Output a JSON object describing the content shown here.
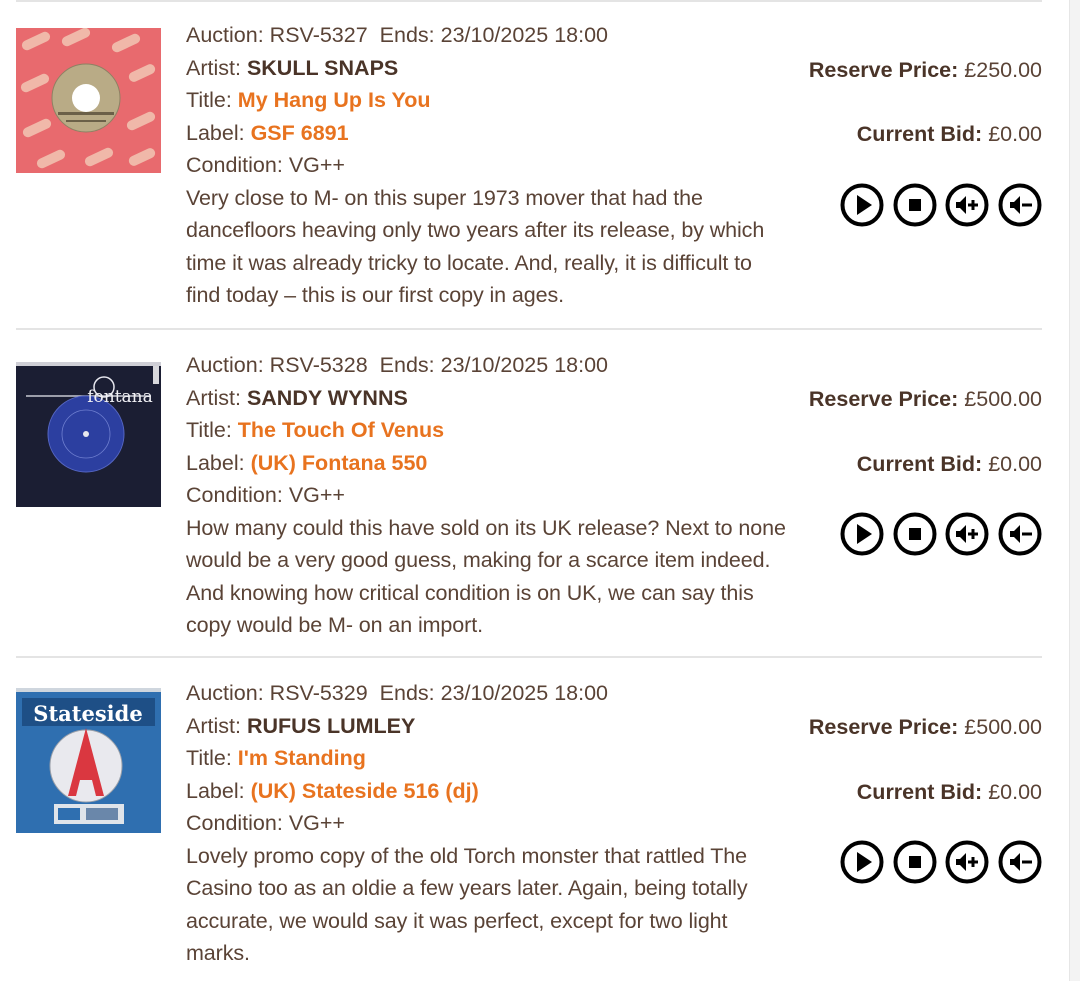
{
  "labels": {
    "auction": "Auction:",
    "ends": "Ends:",
    "artist": "Artist:",
    "title": "Title:",
    "label": "Label:",
    "condition": "Condition:",
    "reserve_price": "Reserve Price:",
    "current_bid": "Current Bid:"
  },
  "listings": [
    {
      "auction_id": "RSV-5327",
      "ends": "23/10/2025 18:00",
      "artist": "SKULL SNAPS",
      "title": "My Hang Up Is You",
      "label": "GSF 6891",
      "condition": "VG++",
      "description": "Very close to M- on this super 1973 mover that had the dancefloors heaving only two years after its release, by which time it was already tricky to locate. And, really, it is difficult to find today – this is our first copy in ages.",
      "reserve_price": "£250.00",
      "current_bid": "£0.00"
    },
    {
      "auction_id": "RSV-5328",
      "ends": "23/10/2025 18:00",
      "artist": "SANDY WYNNS",
      "title": "The Touch Of Venus",
      "label": "(UK) Fontana 550",
      "condition": "VG++",
      "description": "How many could this have sold on its UK release? Next to none would be a very good guess, making for a scarce item indeed. And knowing how critical condition is on UK, we can say this copy would be M- on an import.",
      "reserve_price": "£500.00",
      "current_bid": "£0.00",
      "sleeve_brand": "fontana"
    },
    {
      "auction_id": "RSV-5329",
      "ends": "23/10/2025 18:00",
      "artist": "RUFUS LUMLEY",
      "title": "I'm Standing",
      "label": "(UK) Stateside 516 (dj)",
      "condition": "VG++",
      "description": "Lovely promo copy of the old Torch monster that rattled The Casino too as an oldie a few years later. Again, being totally accurate, we would say it was perfect, except for two light marks.",
      "reserve_price": "£500.00",
      "current_bid": "£0.00",
      "sleeve_brand": "Stateside"
    }
  ],
  "controls": [
    "play-icon",
    "stop-icon",
    "volume-up-icon",
    "volume-down-icon"
  ],
  "colors": {
    "accent": "#e8731f",
    "text": "#5a4336",
    "text_strong": "#4a3428",
    "divider": "#e4e4e4"
  }
}
